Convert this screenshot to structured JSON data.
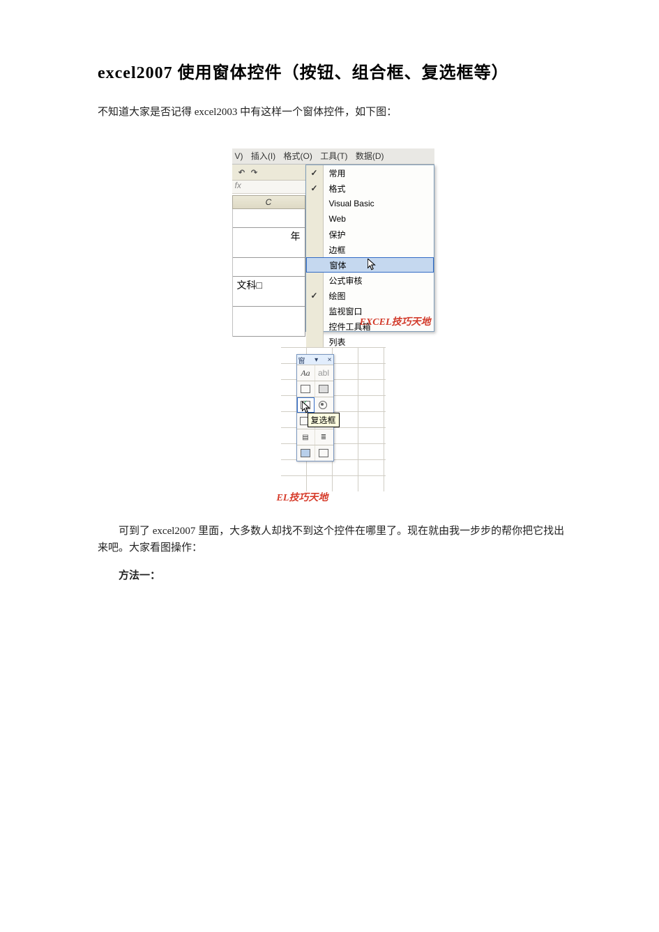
{
  "title": "excel2007 使用窗体控件（按钮、组合框、复选框等）",
  "intro": "不知道大家是否记得 excel2003 中有这样一个窗体控件，如下图：",
  "para2": "可到了 excel2007 里面，大多数人却找不到这个控件在哪里了。现在就由我一步步的帮你把它找出来吧。大家看图操作：",
  "method1": "方法一：",
  "fig1": {
    "menubar": {
      "view": "V)",
      "insert": "插入(I)",
      "format": "格式(O)",
      "tools": "工具(T)",
      "data": "数据(D)"
    },
    "toolbar": {
      "undo_icon": "↶",
      "redo_icon": "↷"
    },
    "fx_label": "fx",
    "col_header": "C",
    "cells": {
      "c3_label": "年",
      "c5_label": "文科□"
    },
    "menu": {
      "items": [
        {
          "label": "常用",
          "checked": true
        },
        {
          "label": "格式",
          "checked": true
        },
        {
          "label": "Visual Basic",
          "checked": false
        },
        {
          "label": "Web",
          "checked": false
        },
        {
          "label": "保护",
          "checked": false
        },
        {
          "label": "边框",
          "checked": false
        },
        {
          "label": "窗体",
          "checked": false,
          "highlighted": true
        },
        {
          "label": "公式审核",
          "checked": false
        },
        {
          "label": "绘图",
          "checked": true
        },
        {
          "label": "监视窗口",
          "checked": false
        },
        {
          "label": "控件工具箱",
          "checked": false
        },
        {
          "label": "列表",
          "checked": false
        }
      ]
    },
    "watermark": "EXCEL技巧天地"
  },
  "fig2": {
    "panel_title": {
      "window_icon": "窗",
      "dropdown_icon": "▾",
      "close_icon": "×"
    },
    "buttons": [
      [
        "Aa",
        "abl"
      ],
      [
        "□",
        "≡"
      ],
      [
        "☑",
        "◉"
      ],
      [
        "▭",
        "▭"
      ],
      [
        "▤",
        "🔒"
      ],
      [
        "▭",
        "▭"
      ]
    ],
    "selected_button_label": "复选框",
    "tooltip": "复选框",
    "watermark": "EL技巧天地"
  }
}
